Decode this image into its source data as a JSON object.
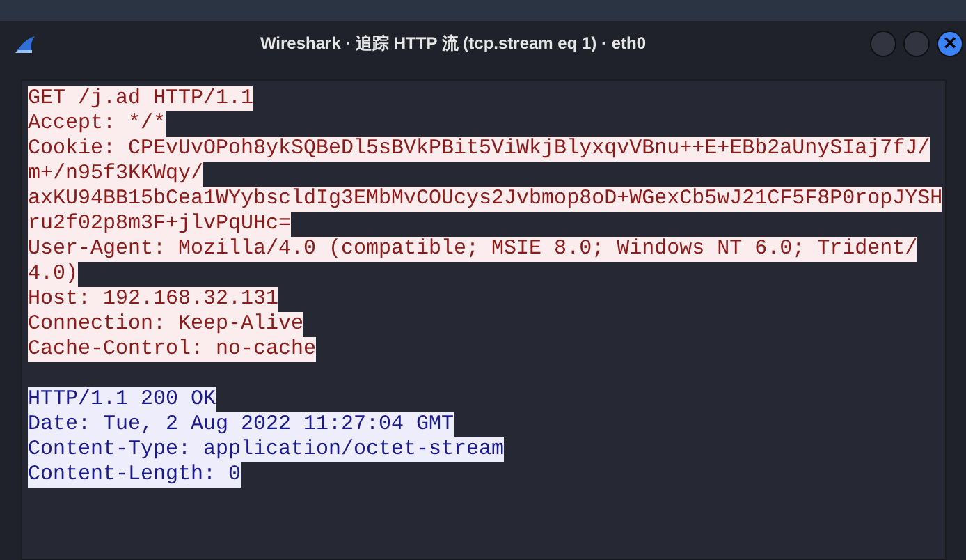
{
  "window": {
    "title": "Wireshark · 追踪 HTTP 流 (tcp.stream eq 1) · eth0",
    "close_symbol": "×"
  },
  "stream": [
    {
      "kind": "client",
      "lines": [
        "GET /j.ad HTTP/1.1",
        "Accept: */*",
        "Cookie: CPEvUvOPoh8ykSQBeDl5sBVkPBit5ViWkjBlyxqvVBnu++E+EBb2aUnySIaj7fJ/",
        "m+/n95f3KKWqy/",
        "axKU94BB15bCea1WYybscldIg3EMbMvCOUcys2Jvbmop8oD+WGexCb5wJ21CF5F8P0ropJYSH",
        "ru2f02p8m3F+jlvPqUHc=",
        "User-Agent: Mozilla/4.0 (compatible; MSIE 8.0; Windows NT 6.0; Trident/",
        "4.0)",
        "Host: 192.168.32.131",
        "Connection: Keep-Alive",
        "Cache-Control: no-cache"
      ]
    },
    {
      "kind": "server",
      "lines": [
        "HTTP/1.1 200 OK",
        "Date: Tue, 2 Aug 2022 11:27:04 GMT",
        "Content-Type: application/octet-stream",
        "Content-Length: 0"
      ]
    }
  ]
}
